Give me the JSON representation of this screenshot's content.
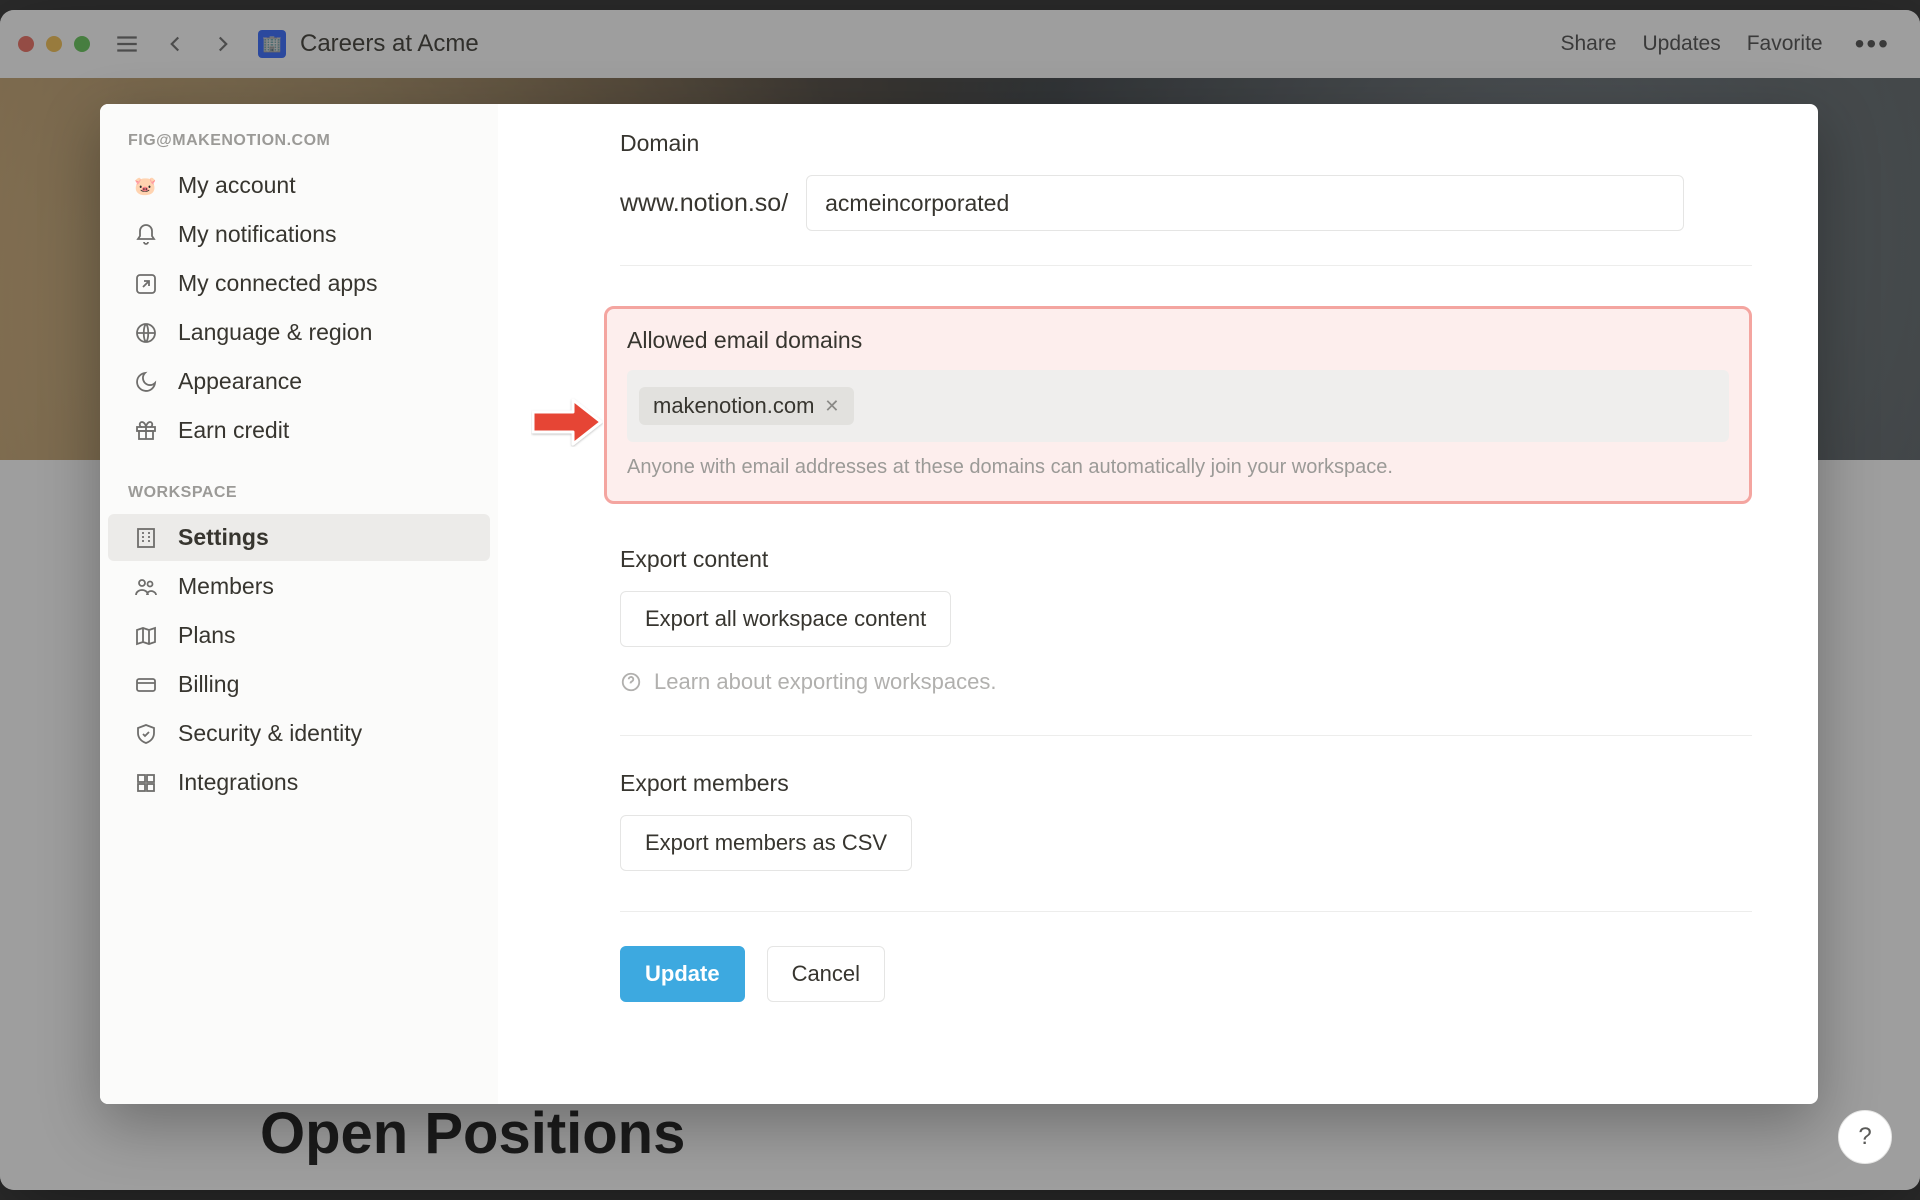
{
  "header": {
    "page_title": "Careers at Acme",
    "top_links": [
      "Share",
      "Updates",
      "Favorite"
    ]
  },
  "page": {
    "open_positions_heading": "Open Positions"
  },
  "sidebar": {
    "account_label": "FIG@MAKENOTION.COM",
    "items_account": [
      {
        "icon": "avatar-pig",
        "label": "My account"
      },
      {
        "icon": "bell",
        "label": "My notifications"
      },
      {
        "icon": "arrow-up-right-box",
        "label": "My connected apps"
      },
      {
        "icon": "globe",
        "label": "Language & region"
      },
      {
        "icon": "moon",
        "label": "Appearance"
      },
      {
        "icon": "gift",
        "label": "Earn credit"
      }
    ],
    "workspace_label": "WORKSPACE",
    "items_workspace": [
      {
        "icon": "building",
        "label": "Settings",
        "active": true
      },
      {
        "icon": "people",
        "label": "Members"
      },
      {
        "icon": "map",
        "label": "Plans"
      },
      {
        "icon": "card",
        "label": "Billing"
      },
      {
        "icon": "shield",
        "label": "Security & identity"
      },
      {
        "icon": "grid",
        "label": "Integrations"
      }
    ]
  },
  "settings": {
    "domain": {
      "title": "Domain",
      "prefix": "www.notion.so/",
      "value": "acmeincorporated"
    },
    "allowed": {
      "title": "Allowed email domains",
      "chip_value": "makenotion.com",
      "helper": "Anyone with email addresses at these domains can automatically join your workspace."
    },
    "export_content": {
      "title": "Export content",
      "button": "Export all workspace content",
      "learn": "Learn about exporting workspaces."
    },
    "export_members": {
      "title": "Export members",
      "button": "Export members as CSV"
    },
    "footer": {
      "update": "Update",
      "cancel": "Cancel"
    }
  }
}
